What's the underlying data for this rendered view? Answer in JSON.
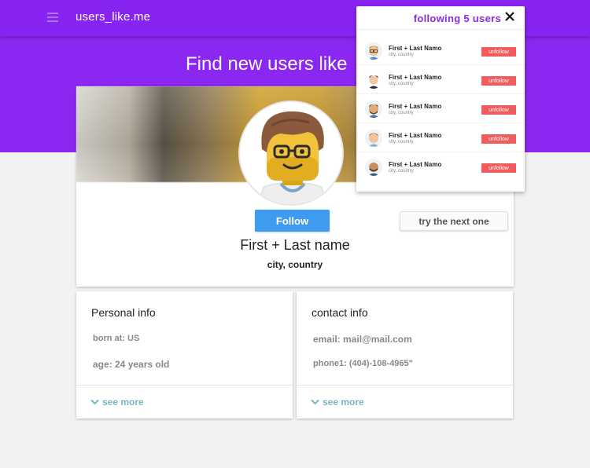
{
  "header": {
    "brand": "users_like.me",
    "hero_title": "Find new users like"
  },
  "profile": {
    "follow_label": "Follow",
    "next_label": "try the next one",
    "name": "First + Last name",
    "location": "city, country"
  },
  "personal_info": {
    "title": "Personal info",
    "born": "born at: US",
    "age": "age: 24 years old",
    "see_more": "see more"
  },
  "contact_info": {
    "title": "contact info",
    "email": "email: mail@mail.com",
    "phone": "phone1: (404)-108-4965\"",
    "see_more": "see more"
  },
  "following": {
    "title": "following 5 users",
    "users": [
      {
        "name": "First + Last Namo",
        "location": "city, country",
        "action": "unfollow",
        "avatar": "glasses-man-icon"
      },
      {
        "name": "First + Last Namo",
        "location": "city, country",
        "action": "unfollow",
        "avatar": "dark-hair-man-icon"
      },
      {
        "name": "First + Last Namo",
        "location": "city, country",
        "action": "unfollow",
        "avatar": "beard-man-icon"
      },
      {
        "name": "First + Last Namo",
        "location": "city, country",
        "action": "unfollow",
        "avatar": "red-hair-man-icon"
      },
      {
        "name": "First + Last Namo",
        "location": "city, country",
        "action": "unfollow",
        "avatar": "bald-man-icon"
      }
    ]
  },
  "colors": {
    "header_purple": "#8824f2",
    "follow_blue": "#3f9bf0",
    "unfollow_red": "#f05b5b",
    "see_more_teal": "#79b5c1"
  }
}
